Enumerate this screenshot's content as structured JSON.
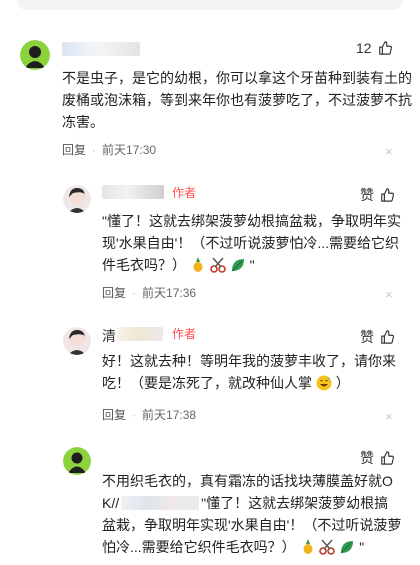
{
  "comments": [
    {
      "like_count": "12",
      "text": "不是虫子，是它的幼根，你可以拿这个牙苗种到装有土的废桶或泡沫箱，等到来年你也有菠萝吃了，不过菠萝不抗冻害。",
      "reply_label": "回复",
      "separator": "·",
      "time": "前天17:30"
    }
  ],
  "replies": [
    {
      "author_tag": "作者",
      "like_label": "赞",
      "text": "\"懂了！这就去绑架菠萝幼根搞盆栽，争取明年实现'水果自由'！（不过听说菠萝怕冷...需要给它织件毛衣吗？）",
      "text_end": "\"",
      "reply_label": "回复",
      "separator": "·",
      "time": "前天17:36"
    },
    {
      "name_prefix": "清",
      "author_tag": "作者",
      "like_label": "赞",
      "text": "好！这就去种！等明年我的菠萝丰收了，请你来吃！（要是冻死了，就改种仙人掌",
      "text_end": "）",
      "reply_label": "回复",
      "separator": "·",
      "time": "前天17:38"
    },
    {
      "like_label": "赞",
      "text_a": "不用织毛衣的，真有霜冻的话找块薄膜盖好就OK//",
      "text_b": "\"懂了！这就去绑架菠萝幼根搞盆栽，争取明年实现'水果自由'！（不过听说菠萝怕冷...需要给它织件毛衣吗？）",
      "text_end": "\""
    }
  ],
  "icons": {
    "close": "×",
    "thumb": "thumb-up-icon"
  },
  "colors": {
    "author_tag": "#ff4d4f",
    "avatar_green": "#8cd23c"
  }
}
